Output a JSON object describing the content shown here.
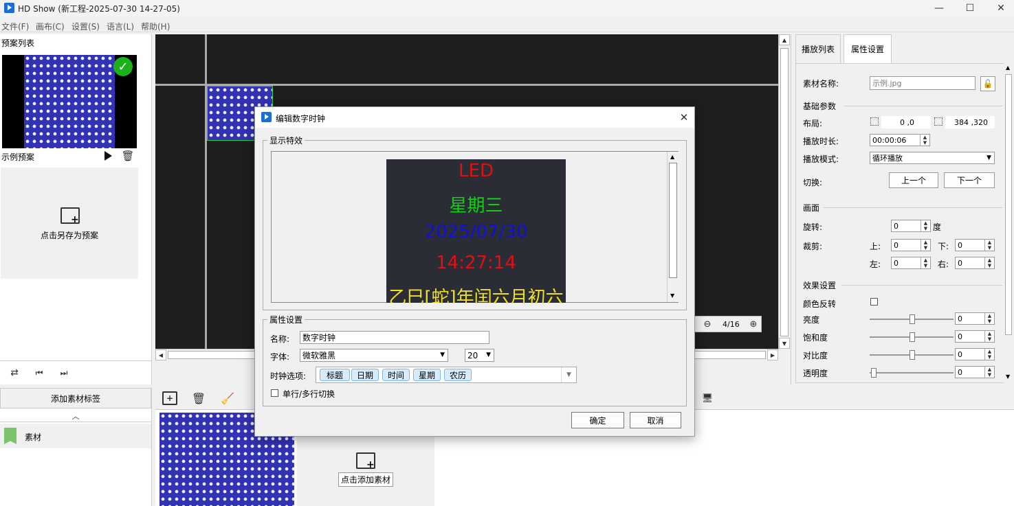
{
  "window": {
    "title": "HD Show (新工程-2025-07-30 14-27-05)",
    "minimize": "—",
    "maximize": "☐",
    "close": "✕"
  },
  "menu": [
    {
      "label": "文件(F)"
    },
    {
      "label": "画布(C)"
    },
    {
      "label": "设置(S)"
    },
    {
      "label": "语言(L)"
    },
    {
      "label": "帮助(H)"
    }
  ],
  "left_panel": {
    "title": "预案列表",
    "preset_name": "示例预案",
    "save_as_label": "点击另存为预案",
    "add_tag_label": "添加素材标签",
    "tag_name": "素材"
  },
  "media_panel": {
    "add_media_label": "点击添加素材"
  },
  "canvas": {
    "zoom_text": "4/16"
  },
  "right_panel": {
    "tabs": [
      {
        "label": "播放列表"
      },
      {
        "label": "属性设置"
      }
    ],
    "material_name_label": "素材名称:",
    "material_name_value": "示例.jpg",
    "basic_params": "基础参数",
    "layout_label": "布局:",
    "layout_pos": "0 ,0",
    "layout_size": "384 ,320",
    "duration_label": "播放时长:",
    "duration_value": "00:00:06",
    "mode_label": "播放模式:",
    "mode_value": "循环播放",
    "switch_label": "切换:",
    "prev_button": "上一个",
    "next_button": "下一个",
    "frame_section": "画面",
    "rotate_label": "旋转:",
    "rotate_value": "0",
    "rotate_unit": "度",
    "crop_label": "裁剪:",
    "crop_top_label": "上:",
    "crop_top": "0",
    "crop_bottom_label": "下:",
    "crop_bottom": "0",
    "crop_left_label": "左:",
    "crop_left": "0",
    "crop_right_label": "右:",
    "crop_right": "0",
    "effect_section": "效果设置",
    "invert_label": "颜色反转",
    "brightness_label": "亮度",
    "brightness_value": "0",
    "saturation_label": "饱和度",
    "saturation_value": "0",
    "contrast_label": "对比度",
    "contrast_value": "0",
    "opacity_label": "透明度",
    "opacity_value": "0"
  },
  "dialog": {
    "title": "编辑数字时钟",
    "preview_group": "显示特效",
    "led_lines": [
      {
        "text": "LED",
        "color": "#e01010"
      },
      {
        "text": "星期三",
        "color": "#10d010"
      },
      {
        "text": "2025/07/30",
        "color": "#1010d8"
      },
      {
        "text": "14:27:14",
        "color": "#e01010"
      },
      {
        "text": "乙巳[蛇]年闰六月初六",
        "color": "#f0e020"
      }
    ],
    "props_group": "属性设置",
    "name_label": "名称:",
    "name_value": "数字时钟",
    "font_label": "字体:",
    "font_value": "微软雅黑",
    "font_size": "20",
    "clock_options_label": "时钟选项:",
    "clock_options": [
      {
        "label": "标题"
      },
      {
        "label": "日期"
      },
      {
        "label": "时间"
      },
      {
        "label": "星期"
      },
      {
        "label": "农历"
      }
    ],
    "multiline_label": "单行/多行切换",
    "ok_button": "确定",
    "cancel_button": "取消"
  },
  "colors": {
    "accent": "#1a6fd6",
    "canvas_bg": "#1e1e1e",
    "led_bg": "#2b2d36",
    "check_green": "#1bb11b",
    "tag_green": "#7cc36b"
  }
}
